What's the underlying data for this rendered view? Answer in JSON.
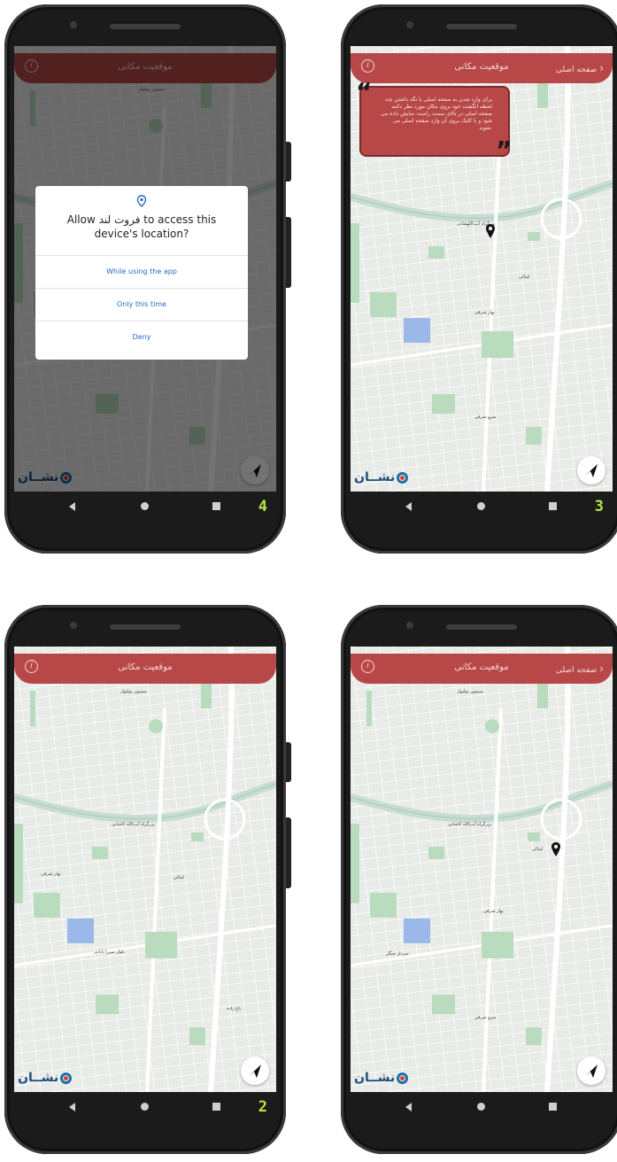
{
  "app": {
    "title": "موقعیت مکانی",
    "back_label": "صفحه اصلی",
    "info_glyph": "i",
    "logo_text": "نشــان",
    "accent_color": "#b84848"
  },
  "screens": [
    {
      "number": "4",
      "permission_dialog": {
        "message": "Allow فروت لند to access this device's location?",
        "options": [
          "While using the app",
          "Only this time",
          "Deny"
        ]
      }
    },
    {
      "number": "3",
      "hint": "برای وارد شدن به صفحه اصلی با نگه داشتن چند لحظه انگشت خود بروی مکان مورد نظر دکمه صفحه اصلی در بالای سمت راست نمایش داده می شود و با کلیک بروی آن وارد صفحه اصلی می شوید."
    },
    {
      "number": "2"
    },
    {
      "number": "1"
    }
  ],
  "map_labels": {
    "top": "سیمون بولیوار",
    "highway": "بزرگراه آیت‌اللهشانی",
    "highway_b": "بزرگراه آیت‌الله کاشانی",
    "street_a": "کمالی",
    "street_b": "بهار شرقی",
    "street_c": "اردیبهشت",
    "street_d": "شاهین",
    "street_e": "پونک",
    "street_f": "سردار جنگل",
    "street_g": "بلوار میرزا بابایی",
    "street_h": "فلامک",
    "street_i": "سرو شرقی",
    "street_j": "باغ زاده"
  },
  "colors": {
    "map_bg": "#e9ebe8",
    "park": "#b8dcbd",
    "water": "#9ab9e8",
    "highway": "#c7dcd3",
    "dialog_btn": "#2a68c8"
  }
}
